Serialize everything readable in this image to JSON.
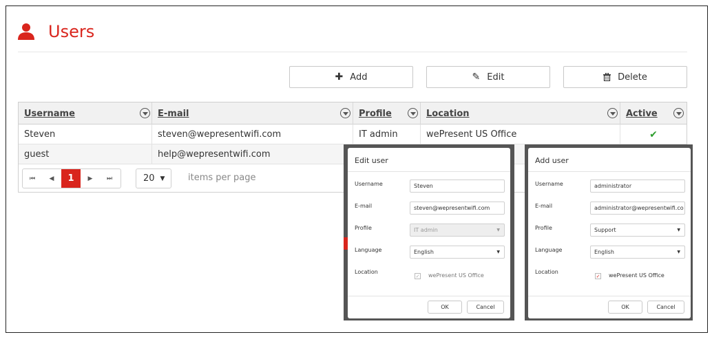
{
  "page": {
    "title": "Users",
    "icon": "user-icon",
    "accent_color": "#d9251d"
  },
  "toolbar": {
    "add_label": "Add",
    "add_icon": "plus-icon",
    "edit_label": "Edit",
    "edit_icon": "pencil-icon",
    "delete_label": "Delete",
    "delete_icon": "trash-icon"
  },
  "table": {
    "columns": [
      "Username",
      "E-mail",
      "Profile",
      "Location",
      "Active"
    ],
    "rows": [
      {
        "username": "Steven",
        "email": "steven@wepresentwifi.com",
        "profile": "IT admin",
        "location": "wePresent US Office",
        "active": "✔"
      },
      {
        "username": "guest",
        "email": "help@wepresentwifi.com",
        "profile": "",
        "location": "",
        "active": ""
      }
    ]
  },
  "pager": {
    "current_page": "1",
    "page_size": "20",
    "items_per_page_label": "items per page"
  },
  "edit_dialog": {
    "title": "Edit user",
    "username_label": "Username",
    "username_value": "Steven",
    "email_label": "E-mail",
    "email_value": "steven@wepresentwifi.com",
    "profile_label": "Profile",
    "profile_value": "IT admin",
    "language_label": "Language",
    "language_value": "English",
    "location_label": "Location",
    "location_option": "wePresent US Office",
    "ok_label": "OK",
    "cancel_label": "Cancel"
  },
  "add_dialog": {
    "title": "Add user",
    "username_label": "Username",
    "username_value": "administrator",
    "email_label": "E-mail",
    "email_value": "administrator@wepresentwifi.co",
    "profile_label": "Profile",
    "profile_value": "Support",
    "language_label": "Language",
    "language_value": "English",
    "location_label": "Location",
    "location_option": "wePresent US Office",
    "ok_label": "OK",
    "cancel_label": "Cancel"
  }
}
